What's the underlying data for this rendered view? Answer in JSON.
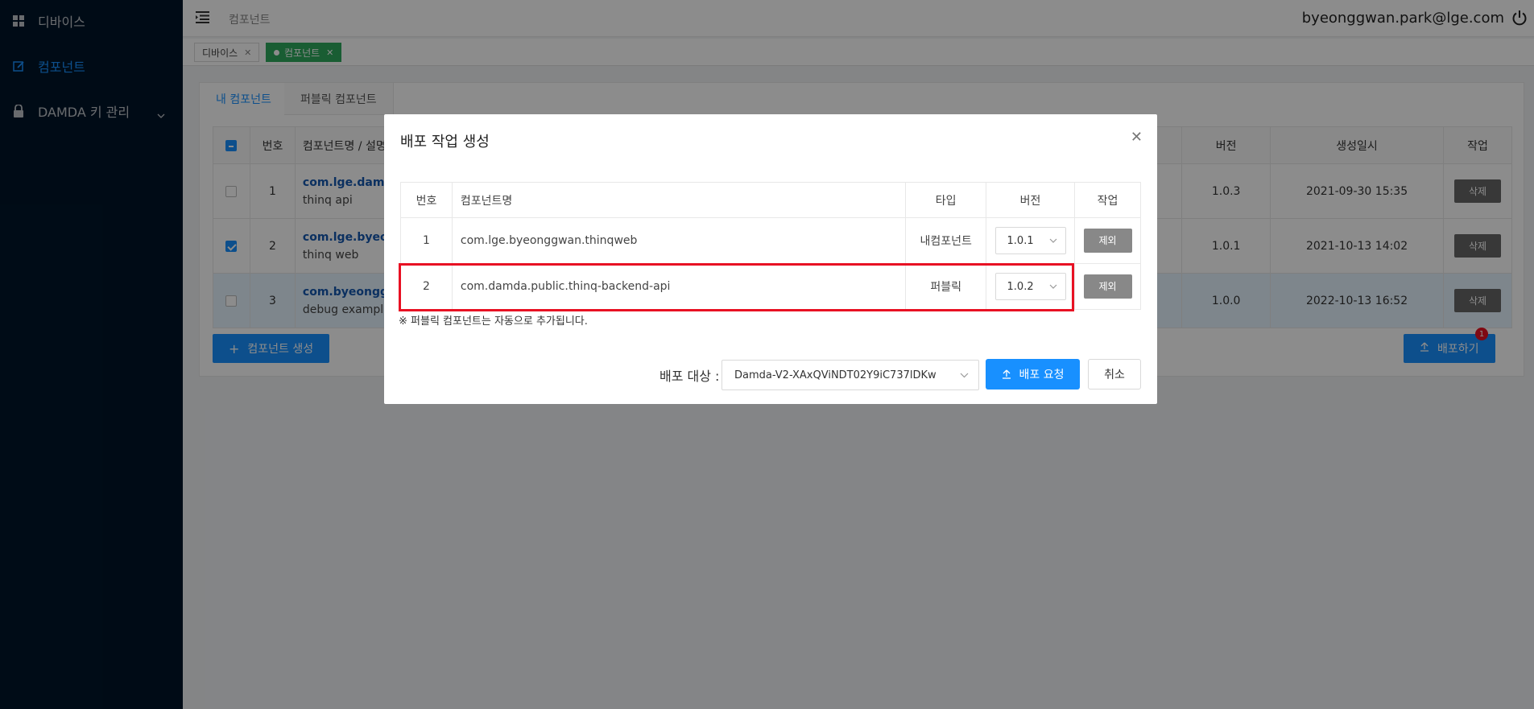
{
  "sidebar": {
    "items": [
      {
        "label": "디바이스",
        "icon": "grid-icon"
      },
      {
        "label": "컴포넌트",
        "icon": "edit-icon"
      },
      {
        "label": "DAMDA 키 관리",
        "icon": "lock-icon"
      }
    ]
  },
  "header": {
    "breadcrumb": "컴포넌트",
    "user_email": "byeonggwan.park@lge.com"
  },
  "page_tabs": [
    {
      "label": "디바이스"
    },
    {
      "label": "컴포넌트"
    }
  ],
  "content_tabs": {
    "my": "내 컴포넌트",
    "public": "퍼블릭 컴포넌트"
  },
  "bg_table": {
    "headers": {
      "no": "번호",
      "name": "컴포넌트명 / 설명",
      "version": "버전",
      "created": "생성일시",
      "action": "작업"
    },
    "rows": [
      {
        "no": "1",
        "name": "com.lge.damd",
        "desc": "thinq api",
        "version": "1.0.3",
        "created": "2021-09-30 15:35",
        "action": "삭제"
      },
      {
        "no": "2",
        "name": "com.lge.byeo",
        "desc": "thinq web",
        "version": "1.0.1",
        "created": "2021-10-13 14:02",
        "action": "삭제"
      },
      {
        "no": "3",
        "name": "com.byeongg",
        "desc": "debug exampl",
        "version": "1.0.0",
        "created": "2022-10-13 16:52",
        "action": "삭제"
      }
    ]
  },
  "create_button": "컴포넌트 생성",
  "deploy_button": "배포하기",
  "deploy_badge": "1",
  "modal": {
    "title": "배포 작업 생성",
    "headers": {
      "no": "번호",
      "name": "컴포넌트명",
      "type": "타입",
      "version": "버전",
      "action": "작업"
    },
    "rows": [
      {
        "no": "1",
        "name": "com.lge.byeonggwan.thinqweb",
        "type": "내컴포넌트",
        "version": "1.0.1",
        "action": "제외"
      },
      {
        "no": "2",
        "name": "com.damda.public.thinq-backend-api",
        "type": "퍼블릭",
        "version": "1.0.2",
        "action": "제외"
      }
    ],
    "note": "※ 퍼블릭 컴포넌트는 자동으로 추가됩니다.",
    "deploy_target_label": "배포 대상 :",
    "deploy_target_value": "Damda-V2-XAxQViNDT02Y9iC737lDKw",
    "request_button": "배포 요청",
    "cancel_button": "취소",
    "highlight_color": "#e81123"
  },
  "colors": {
    "accent": "#1890ff",
    "sidebar_bg": "#001529",
    "active_tab": "#2eaa5e"
  }
}
